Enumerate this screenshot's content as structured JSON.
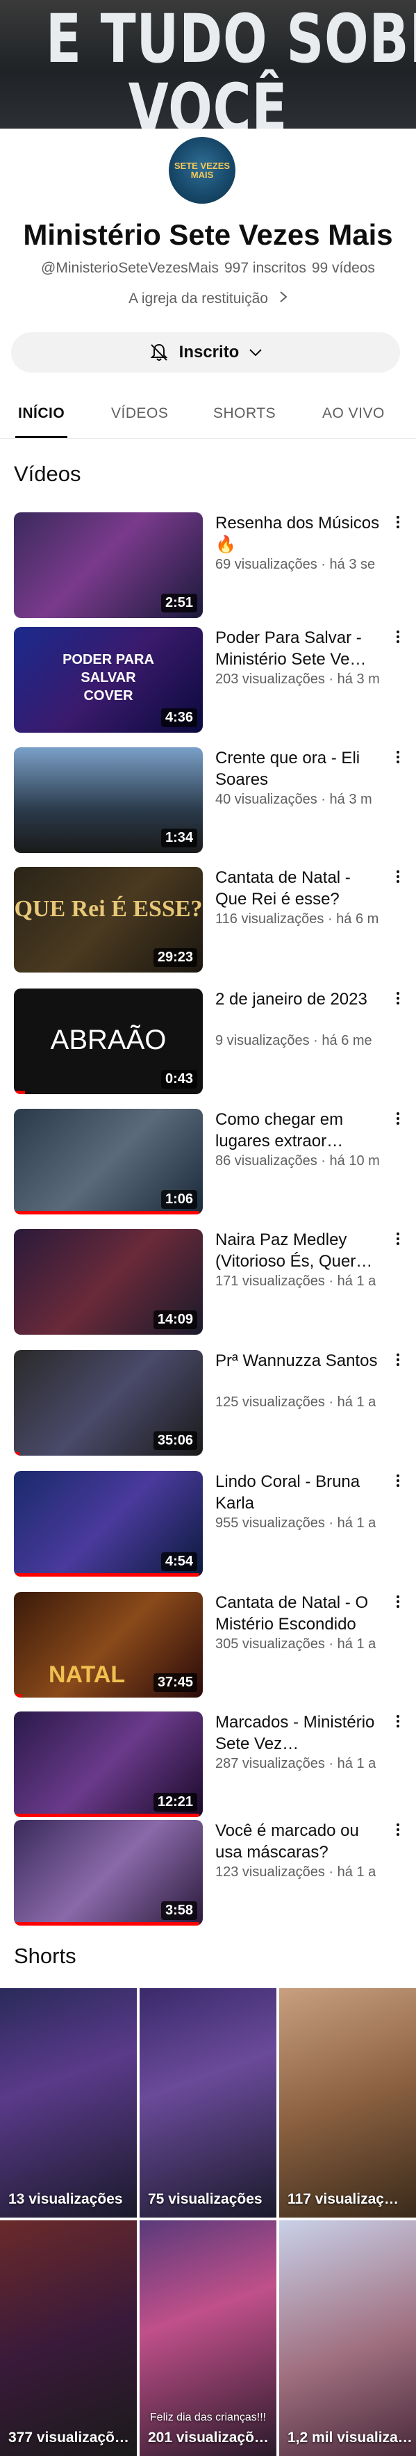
{
  "banner": {
    "line1": "E TUDO SOBRE",
    "line2": "VOCÊ"
  },
  "channel": {
    "avatar_label": "SETE VEZES MAIS",
    "name": "Ministério Sete Vezes Mais",
    "handle": "@MinisterioSeteVezesMais",
    "subscribers": "997 inscritos",
    "videos_count": "99 vídeos",
    "link_text": "A igreja da restituição",
    "subscribe_label": "Inscrito"
  },
  "tabs": [
    {
      "label": "INÍCIO",
      "active": true
    },
    {
      "label": "VÍDEOS",
      "active": false
    },
    {
      "label": "SHORTS",
      "active": false
    },
    {
      "label": "AO VIVO",
      "active": false
    }
  ],
  "videos_section": {
    "title": "Vídeos"
  },
  "videos": [
    {
      "title": "Resenha dos Músicos 🔥",
      "meta": "69 visualizações · há 3 se",
      "duration": "2:51",
      "thumb_text": "",
      "watched": 0
    },
    {
      "title": "Poder Para Salvar - Ministério Sete Ve…",
      "meta": "203 visualizações · há 3 m",
      "duration": "4:36",
      "thumb_text": "PODER PARA SALVAR COVER",
      "watched": 0
    },
    {
      "title": "Crente que ora - Eli Soares",
      "meta": "40 visualizações · há 3 m",
      "duration": "1:34",
      "thumb_text": "",
      "watched": 0
    },
    {
      "title": "Cantata de Natal - Que Rei é esse?",
      "meta": "116 visualizações · há 6 m",
      "duration": "29:23",
      "thumb_text": "QUE Rei É ESSE?",
      "watched": 0
    },
    {
      "title": "2 de janeiro de 2023",
      "meta": "9 visualizações · há 6 me",
      "duration": "0:43",
      "thumb_text": "ABRAÃO",
      "watched": 0.06
    },
    {
      "title": "Como chegar em lugares extraor…",
      "meta": "86 visualizações · há 10 m",
      "duration": "1:06",
      "thumb_text": "",
      "watched": 0.98
    },
    {
      "title": "Naira Paz Medley (Vitorioso És, Quer…",
      "meta": "171 visualizações · há 1 a",
      "duration": "14:09",
      "thumb_text": "",
      "watched": 0
    },
    {
      "title": "Prª Wannuzza Santos",
      "meta": "125 visualizações · há 1 a",
      "duration": "35:06",
      "thumb_text": "",
      "watched": 0.03
    },
    {
      "title": "Lindo Coral - Bruna Karla",
      "meta": "955 visualizações · há 1 a",
      "duration": "4:54",
      "thumb_text": "",
      "watched": 0.98
    },
    {
      "title": "Cantata de Natal - O Mistério Escondido",
      "meta": "305 visualizações · há 1 a",
      "duration": "37:45",
      "thumb_text": "NATAL",
      "watched": 0.04
    },
    {
      "title": "Marcados - Ministério Sete Vez…",
      "meta": "287 visualizações · há 1 a",
      "duration": "12:21",
      "thumb_text": "",
      "watched": 0.98
    },
    {
      "title": "Você é marcado ou usa máscaras?",
      "meta": "123 visualizações · há 1 a",
      "duration": "3:58",
      "thumb_text": "",
      "watched": 0.98
    }
  ],
  "shorts_section": {
    "title": "Shorts"
  },
  "shorts": [
    {
      "views": "13 visualizações",
      "overlay": ""
    },
    {
      "views": "75 visualizações",
      "overlay": ""
    },
    {
      "views": "117 visualizaç…",
      "overlay": ""
    },
    {
      "views": "377 visualizaçõ…",
      "overlay": ""
    },
    {
      "views": "201 visualizaçõ…",
      "overlay": "Feliz dia das crianças!!!"
    },
    {
      "views": "1,2 mil visualiza…",
      "overlay": ""
    }
  ],
  "colors": {
    "accent_red": "#ff0000",
    "text_primary": "#0f0f0f",
    "text_secondary": "#606060",
    "chip_bg": "#f2f2f2"
  },
  "icons": {
    "subscribe": "bell-off-icon",
    "dropdown": "chevron-down-icon",
    "link": "chevron-right-icon",
    "menu": "more-vert-icon"
  }
}
